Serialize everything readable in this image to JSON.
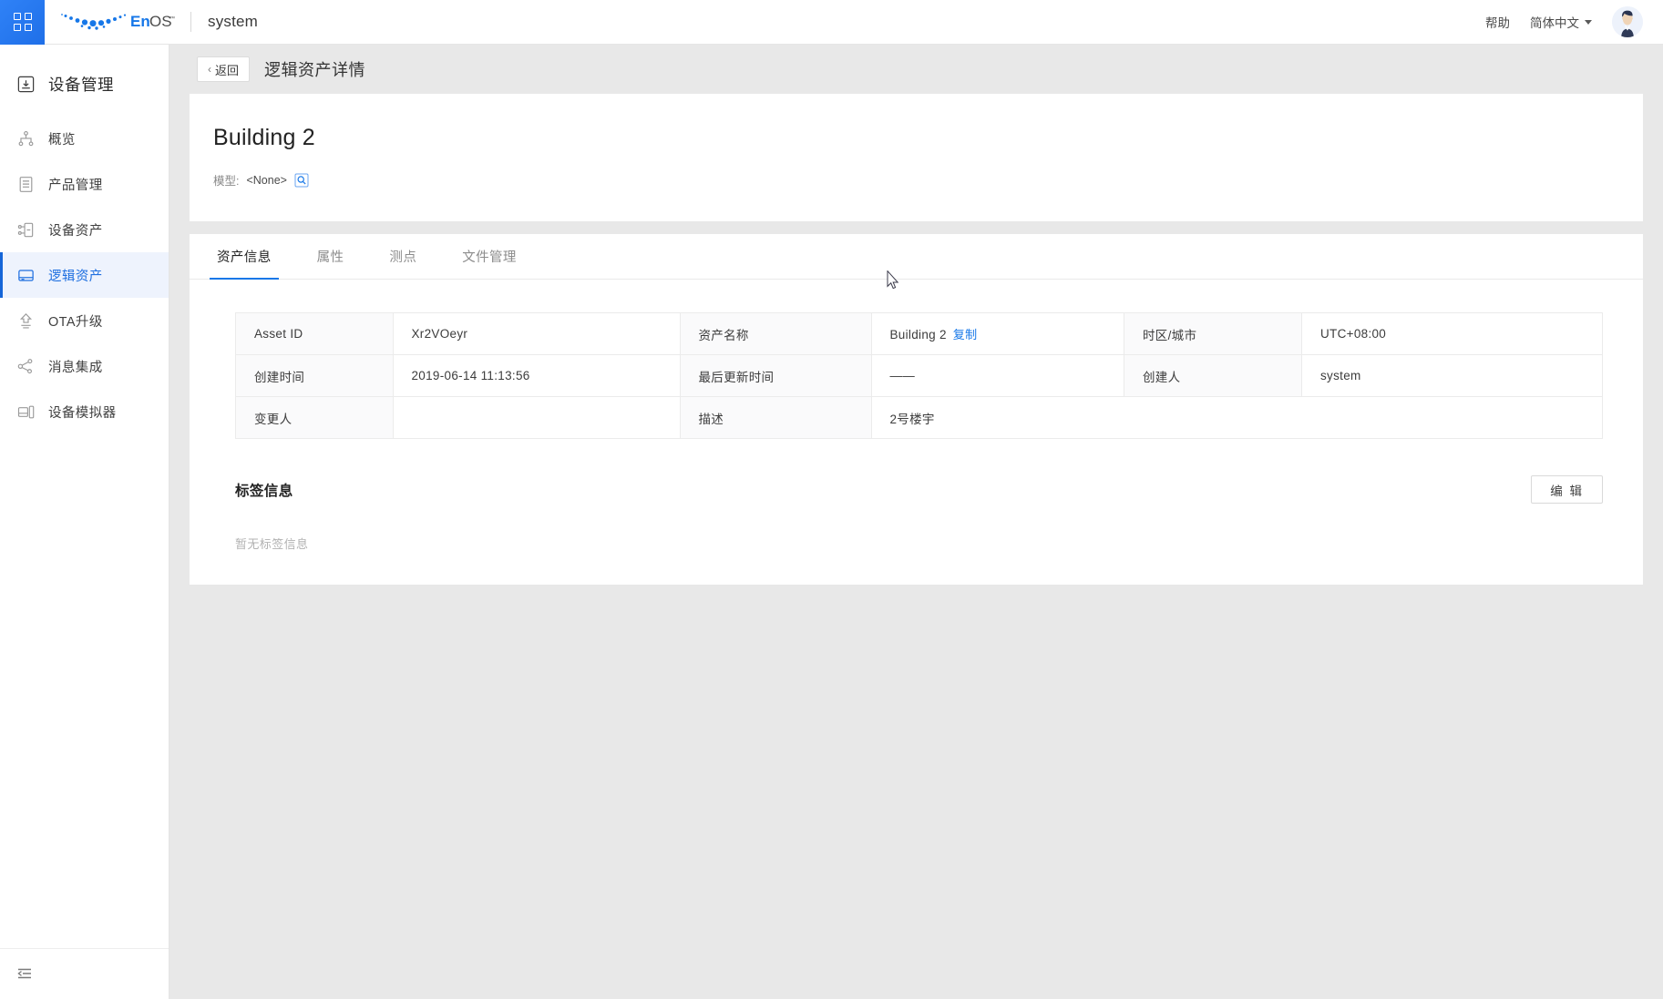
{
  "header": {
    "brand": "EnOS",
    "brand_tm": "™",
    "tenant": "system",
    "help_label": "帮助",
    "language_label": "简体中文",
    "apps_icon": "apps-grid-icon",
    "avatar_icon": "user-avatar"
  },
  "sidebar": {
    "title": "设备管理",
    "title_icon": "device-management-icon",
    "items": [
      {
        "label": "概览",
        "icon": "overview-icon",
        "active": false
      },
      {
        "label": "产品管理",
        "icon": "product-management-icon",
        "active": false
      },
      {
        "label": "设备资产",
        "icon": "device-asset-icon",
        "active": false
      },
      {
        "label": "逻辑资产",
        "icon": "logical-asset-icon",
        "active": true
      },
      {
        "label": "OTA升级",
        "icon": "ota-upgrade-icon",
        "active": false
      },
      {
        "label": "消息集成",
        "icon": "message-integration-icon",
        "active": false
      },
      {
        "label": "设备模拟器",
        "icon": "device-simulator-icon",
        "active": false
      }
    ],
    "collapse_icon": "collapse-sidebar-icon"
  },
  "breadcrumb": {
    "back_label": "返回",
    "back_chevron": "‹",
    "page_title": "逻辑资产详情"
  },
  "asset": {
    "name": "Building 2",
    "model_label": "模型:",
    "model_value": "<None>",
    "model_search_icon": "search-model-icon"
  },
  "tabs": [
    {
      "label": "资产信息",
      "active": true
    },
    {
      "label": "属性",
      "active": false
    },
    {
      "label": "测点",
      "active": false
    },
    {
      "label": "文件管理",
      "active": false
    }
  ],
  "info_table": {
    "rows": [
      {
        "cells": [
          {
            "type": "label",
            "text": "Asset ID"
          },
          {
            "type": "value",
            "text": "Xr2VOeyr"
          },
          {
            "type": "label",
            "text": "资产名称"
          },
          {
            "type": "value",
            "text": "Building 2",
            "link": "复制"
          },
          {
            "type": "label",
            "text": "时区/城市"
          },
          {
            "type": "value",
            "text": "UTC+08:00"
          }
        ]
      },
      {
        "cells": [
          {
            "type": "label",
            "text": "创建时间"
          },
          {
            "type": "value",
            "text": "2019-06-14 11:13:56"
          },
          {
            "type": "label",
            "text": "最后更新时间"
          },
          {
            "type": "value",
            "text": "——"
          },
          {
            "type": "label",
            "text": "创建人"
          },
          {
            "type": "value",
            "text": "system"
          }
        ]
      },
      {
        "cells": [
          {
            "type": "label",
            "text": "变更人"
          },
          {
            "type": "value",
            "text": ""
          },
          {
            "type": "label",
            "text": "描述"
          },
          {
            "type": "value",
            "text": "2号楼宇",
            "colspan": 3
          }
        ]
      }
    ]
  },
  "tag_section": {
    "title": "标签信息",
    "edit_label": "编 辑",
    "empty_text": "暂无标签信息"
  },
  "colors": {
    "accent": "#1677e8",
    "sidebar_active_bg": "#eef3fd",
    "sidebar_active_bar": "#1565d8",
    "page_bg": "#e8e8e8",
    "card_bg": "#ffffff",
    "label_cell_bg": "#fafafb"
  }
}
